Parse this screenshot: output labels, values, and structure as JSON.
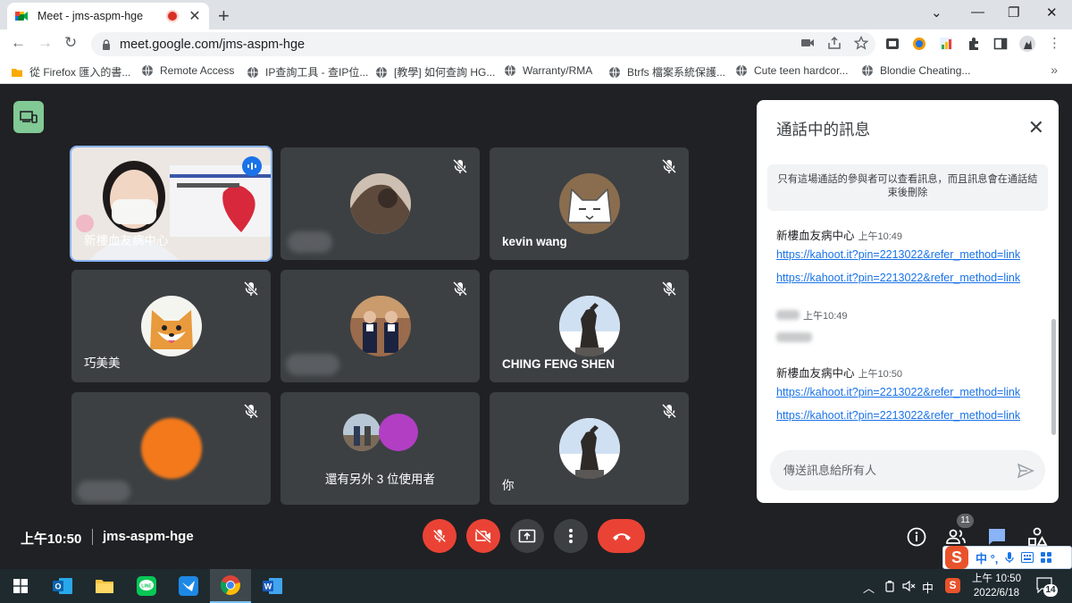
{
  "browser": {
    "tab_title": "Meet - jms-aspm-hge",
    "url": "meet.google.com/jms-aspm-hge",
    "bookmarks": [
      "從 Firefox 匯入的書...",
      "Remote Access",
      "IP查詢工具 - 查IP位...",
      "[教學] 如何查詢 HG...",
      "Warranty/RMA",
      "Btrfs 檔案系統保護...",
      "Cute teen hardcor...",
      "Blondie Cheating..."
    ],
    "bookmarks_more": "»"
  },
  "participants": [
    {
      "name": "新樓血友病中心",
      "active": true
    },
    {
      "name": "",
      "blurred": true
    },
    {
      "name": "kevin wang"
    },
    {
      "name": "巧美美"
    },
    {
      "name": "",
      "blurred": true
    },
    {
      "name": "CHING FENG SHEN"
    },
    {
      "name": "",
      "blurred": true
    },
    {
      "name": "還有另外 3 位使用者"
    },
    {
      "name": "你"
    }
  ],
  "chat": {
    "title": "通話中的訊息",
    "notice": "只有這場通話的參與者可以查看訊息，而且訊息會在通話結束後刪除",
    "messages": [
      {
        "sender": "新樓血友病中心",
        "time": "上午10:49",
        "links": [
          "https://kahoot.it?pin=2213022&refer_method=link",
          "https://kahoot.it?pin=2213022&refer_method=link"
        ]
      },
      {
        "sender": "",
        "time": "上午10:49"
      },
      {
        "sender": "新樓血友病中心",
        "time": "上午10:50",
        "links": [
          "https://kahoot.it?pin=2213022&refer_method=link",
          "https://kahoot.it?pin=2213022&refer_method=link"
        ]
      }
    ],
    "input_placeholder": "傳送訊息給所有人"
  },
  "bottom_bar": {
    "time": "上午10:50",
    "meeting_code": "jms-aspm-hge",
    "people_count": "11"
  },
  "ime": {
    "label": "中 °,"
  },
  "taskbar": {
    "lang": "中",
    "time": "上午 10:50",
    "date": "2022/6/18",
    "notifications": "14"
  },
  "colors": {
    "meet_bg": "#202124",
    "tile_bg": "#3c4043",
    "danger": "#ea4335",
    "accent": "#1a73e8",
    "side_green": "#81c995"
  }
}
